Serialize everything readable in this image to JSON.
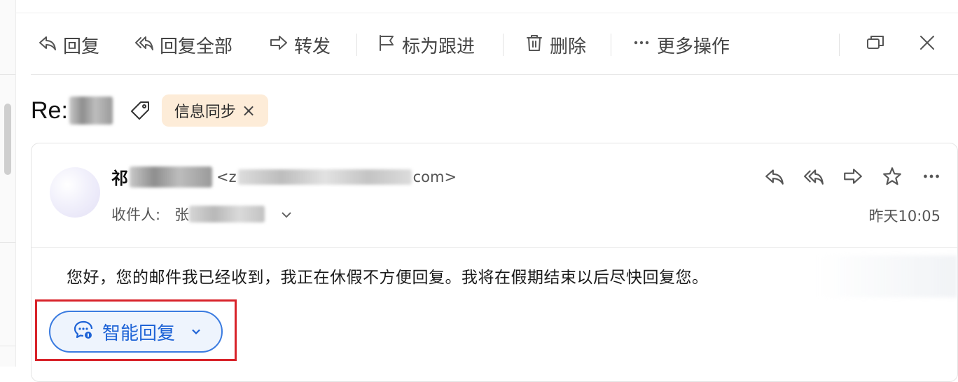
{
  "toolbar": {
    "reply_label": "回复",
    "reply_all_label": "回复全部",
    "forward_label": "转发",
    "flag_label": "标为跟进",
    "delete_label": "删除",
    "more_label": "更多操作"
  },
  "subject": {
    "prefix": "Re:",
    "tag_label": "信息同步",
    "tag_remove": "×"
  },
  "message": {
    "sender_name_visible": "祁",
    "sender_email_prefix": "<z",
    "sender_email_suffix": "com>",
    "to_label": "收件人:",
    "to_value_visible": "张",
    "timestamp": "昨天10:05",
    "body": "您好，您的邮件我已经收到，我正在休假不方便回复。我将在假期结束以后尽快回复您。"
  },
  "smart_reply": {
    "label": "智能回复"
  },
  "colors": {
    "tag_bg": "#fdecd8",
    "smart_reply_accent": "#1e63d6",
    "highlight": "#d8232a"
  },
  "icons": [
    "reply-icon",
    "reply-all-icon",
    "forward-icon",
    "flag-icon",
    "trash-icon",
    "more-icon",
    "restore-window-icon",
    "close-icon",
    "tag-icon",
    "star-icon",
    "chat-ai-icon",
    "chevron-down-icon"
  ]
}
